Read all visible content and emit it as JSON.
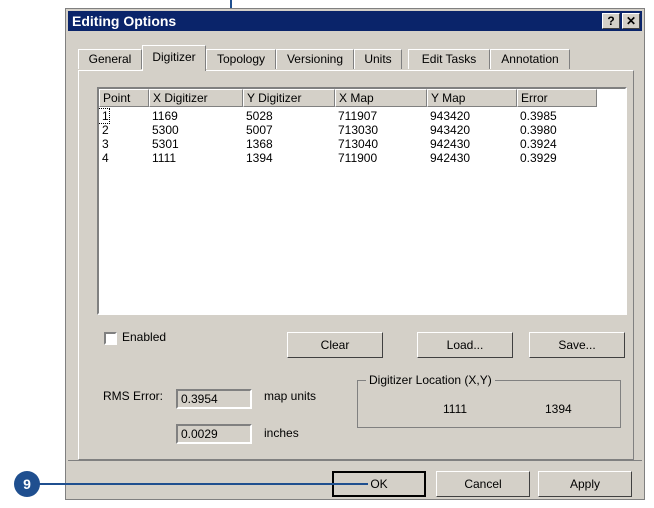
{
  "window": {
    "title": "Editing Options",
    "help_button": "?",
    "close_button": "✕"
  },
  "tabs": [
    "General",
    "Digitizer",
    "Topology",
    "Versioning",
    "Units",
    "Edit Tasks",
    "Annotation"
  ],
  "table": {
    "headers": [
      "Point",
      "X Digitizer",
      "Y Digitizer",
      "X Map",
      "Y Map",
      "Error"
    ],
    "rows": [
      [
        "1",
        "1169",
        "5028",
        "711907",
        "943420",
        "0.3985"
      ],
      [
        "2",
        "5300",
        "5007",
        "713030",
        "943420",
        "0.3980"
      ],
      [
        "3",
        "5301",
        "1368",
        "713040",
        "942430",
        "0.3924"
      ],
      [
        "4",
        "1111",
        "1394",
        "711900",
        "942430",
        "0.3929"
      ]
    ]
  },
  "enabled_label": "Enabled",
  "buttons": {
    "clear": "Clear",
    "load": "Load...",
    "save": "Save...",
    "ok": "OK",
    "cancel": "Cancel",
    "apply": "Apply"
  },
  "rms": {
    "label": "RMS Error:",
    "value_map_units": "0.3954",
    "map_units_label": "map units",
    "value_inches": "0.0029",
    "inches_label": "inches"
  },
  "location": {
    "label": "Digitizer Location (X,Y)",
    "x": "1111",
    "y": "1394"
  },
  "callout": {
    "number": "9"
  }
}
